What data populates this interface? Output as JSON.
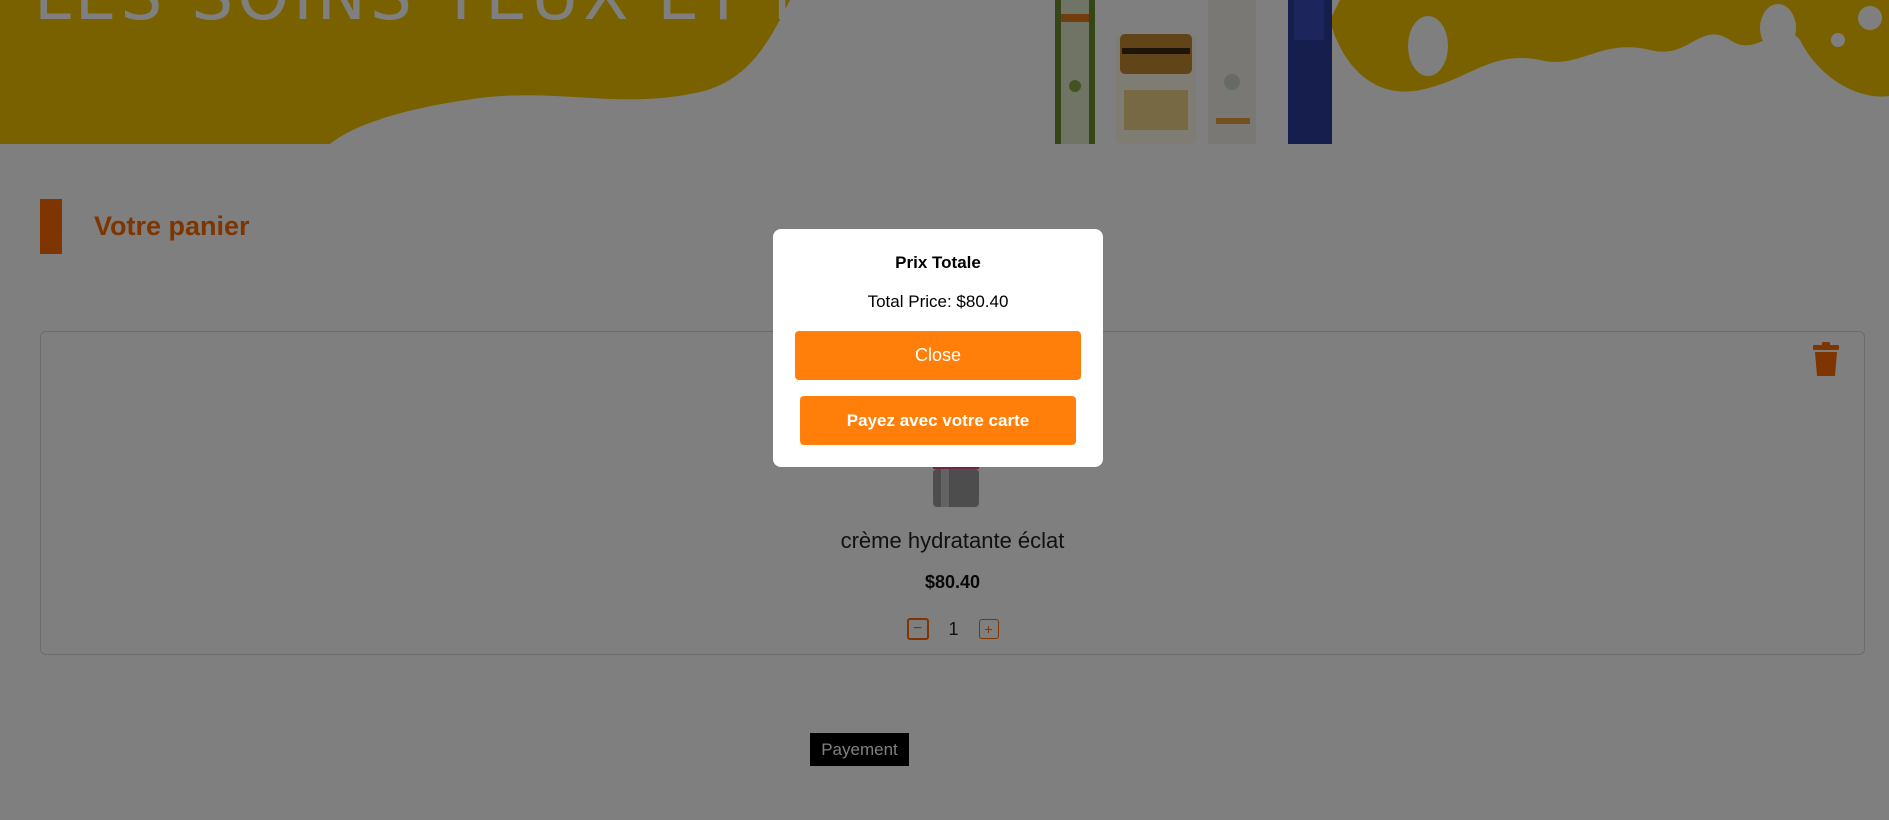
{
  "hero": {
    "title": "LES SOINS YEUX ET LEVRES BIO"
  },
  "section": {
    "title": "Votre panier"
  },
  "cart": {
    "items": [
      {
        "name": "crème hydratante éclat",
        "price": "$80.40",
        "quantity": "1",
        "minus_symbol": "−",
        "plus_symbol": "+"
      }
    ],
    "pay_button_label": "Payement"
  },
  "modal": {
    "title": "Prix Totale",
    "total_text": "Total Price: $80.40",
    "close_label": "Close",
    "pay_label": "Payez avec votre carte"
  },
  "icons": {
    "delete": "trash-icon",
    "decrease": "minus-icon",
    "increase": "plus-icon"
  },
  "colors": {
    "accent": "#ff6a00",
    "button": "#ff7f0a",
    "banner": "#f2c200"
  }
}
